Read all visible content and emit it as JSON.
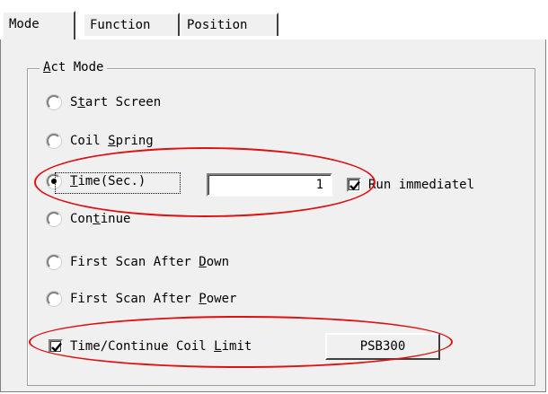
{
  "tabs": [
    {
      "label": "Mode",
      "selected": true
    },
    {
      "label": "Function",
      "selected": false
    },
    {
      "label": "Position",
      "selected": false
    }
  ],
  "group": {
    "title_key": "A",
    "title_rest": "ct Mode"
  },
  "radios": [
    {
      "pre": "S",
      "key": "t",
      "post": "art Screen",
      "checked": false
    },
    {
      "pre": "Coil ",
      "key": "S",
      "post": "pring",
      "checked": false
    },
    {
      "pre": "",
      "key": "T",
      "post": "ime(Sec.)",
      "checked": true
    },
    {
      "pre": "Con",
      "key": "t",
      "post": "inue",
      "checked": false
    },
    {
      "pre": "First Scan After ",
      "key": "D",
      "post": "own",
      "checked": false
    },
    {
      "pre": "First Scan After ",
      "key": "P",
      "post": "ower",
      "checked": false
    }
  ],
  "time_input": {
    "value": "1"
  },
  "run_immediately": {
    "label": "Run immediatel",
    "checked": true
  },
  "coil_limit": {
    "pre": "Time/Continue Coil ",
    "key": "L",
    "post": "imit",
    "checked": true
  },
  "coil_button": {
    "label": "PSB300"
  },
  "annotation_color": "#e01010"
}
